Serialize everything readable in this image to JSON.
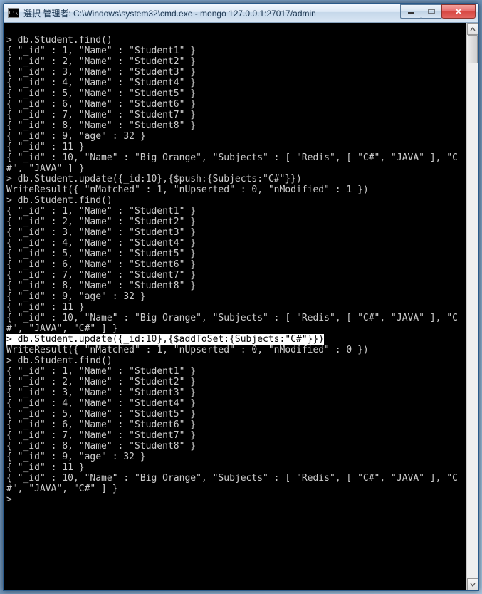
{
  "window": {
    "icon_text": "C:\\",
    "title": "選択 管理者: C:\\Windows\\system32\\cmd.exe - mongo  127.0.0.1:27017/admin"
  },
  "terminal": {
    "lines": [
      {
        "text": "",
        "hl": false
      },
      {
        "text": "> db.Student.find()",
        "hl": false
      },
      {
        "text": "{ \"_id\" : 1, \"Name\" : \"Student1\" }",
        "hl": false
      },
      {
        "text": "{ \"_id\" : 2, \"Name\" : \"Student2\" }",
        "hl": false
      },
      {
        "text": "{ \"_id\" : 3, \"Name\" : \"Student3\" }",
        "hl": false
      },
      {
        "text": "{ \"_id\" : 4, \"Name\" : \"Student4\" }",
        "hl": false
      },
      {
        "text": "{ \"_id\" : 5, \"Name\" : \"Student5\" }",
        "hl": false
      },
      {
        "text": "{ \"_id\" : 6, \"Name\" : \"Student6\" }",
        "hl": false
      },
      {
        "text": "{ \"_id\" : 7, \"Name\" : \"Student7\" }",
        "hl": false
      },
      {
        "text": "{ \"_id\" : 8, \"Name\" : \"Student8\" }",
        "hl": false
      },
      {
        "text": "{ \"_id\" : 9, \"age\" : 32 }",
        "hl": false
      },
      {
        "text": "{ \"_id\" : 11 }",
        "hl": false
      },
      {
        "text": "{ \"_id\" : 10, \"Name\" : \"Big Orange\", \"Subjects\" : [ \"Redis\", [ \"C#\", \"JAVA\" ], \"C#\", \"JAVA\" ] }",
        "hl": false
      },
      {
        "text": "> db.Student.update({_id:10},{$push:{Subjects:\"C#\"}})",
        "hl": false
      },
      {
        "text": "WriteResult({ \"nMatched\" : 1, \"nUpserted\" : 0, \"nModified\" : 1 })",
        "hl": false
      },
      {
        "text": "> db.Student.find()",
        "hl": false
      },
      {
        "text": "{ \"_id\" : 1, \"Name\" : \"Student1\" }",
        "hl": false
      },
      {
        "text": "{ \"_id\" : 2, \"Name\" : \"Student2\" }",
        "hl": false
      },
      {
        "text": "{ \"_id\" : 3, \"Name\" : \"Student3\" }",
        "hl": false
      },
      {
        "text": "{ \"_id\" : 4, \"Name\" : \"Student4\" }",
        "hl": false
      },
      {
        "text": "{ \"_id\" : 5, \"Name\" : \"Student5\" }",
        "hl": false
      },
      {
        "text": "{ \"_id\" : 6, \"Name\" : \"Student6\" }",
        "hl": false
      },
      {
        "text": "{ \"_id\" : 7, \"Name\" : \"Student7\" }",
        "hl": false
      },
      {
        "text": "{ \"_id\" : 8, \"Name\" : \"Student8\" }",
        "hl": false
      },
      {
        "text": "{ \"_id\" : 9, \"age\" : 32 }",
        "hl": false
      },
      {
        "text": "{ \"_id\" : 11 }",
        "hl": false
      },
      {
        "text": "{ \"_id\" : 10, \"Name\" : \"Big Orange\", \"Subjects\" : [ \"Redis\", [ \"C#\", \"JAVA\" ], \"C#\", \"JAVA\", \"C#\" ] }",
        "hl": false
      },
      {
        "text": "> db.Student.update({_id:10},{$addToSet:{Subjects:\"C#\"}})",
        "hl": true
      },
      {
        "text": "WriteResult({ \"nMatched\" : 1, \"nUpserted\" : 0, \"nModified\" : 0 })",
        "hl": false
      },
      {
        "text": "> db.Student.find()",
        "hl": false
      },
      {
        "text": "{ \"_id\" : 1, \"Name\" : \"Student1\" }",
        "hl": false
      },
      {
        "text": "{ \"_id\" : 2, \"Name\" : \"Student2\" }",
        "hl": false
      },
      {
        "text": "{ \"_id\" : 3, \"Name\" : \"Student3\" }",
        "hl": false
      },
      {
        "text": "{ \"_id\" : 4, \"Name\" : \"Student4\" }",
        "hl": false
      },
      {
        "text": "{ \"_id\" : 5, \"Name\" : \"Student5\" }",
        "hl": false
      },
      {
        "text": "{ \"_id\" : 6, \"Name\" : \"Student6\" }",
        "hl": false
      },
      {
        "text": "{ \"_id\" : 7, \"Name\" : \"Student7\" }",
        "hl": false
      },
      {
        "text": "{ \"_id\" : 8, \"Name\" : \"Student8\" }",
        "hl": false
      },
      {
        "text": "{ \"_id\" : 9, \"age\" : 32 }",
        "hl": false
      },
      {
        "text": "{ \"_id\" : 11 }",
        "hl": false
      },
      {
        "text": "{ \"_id\" : 10, \"Name\" : \"Big Orange\", \"Subjects\" : [ \"Redis\", [ \"C#\", \"JAVA\" ], \"C#\", \"JAVA\", \"C#\" ] }",
        "hl": false
      },
      {
        "text": ">",
        "hl": false
      }
    ]
  }
}
